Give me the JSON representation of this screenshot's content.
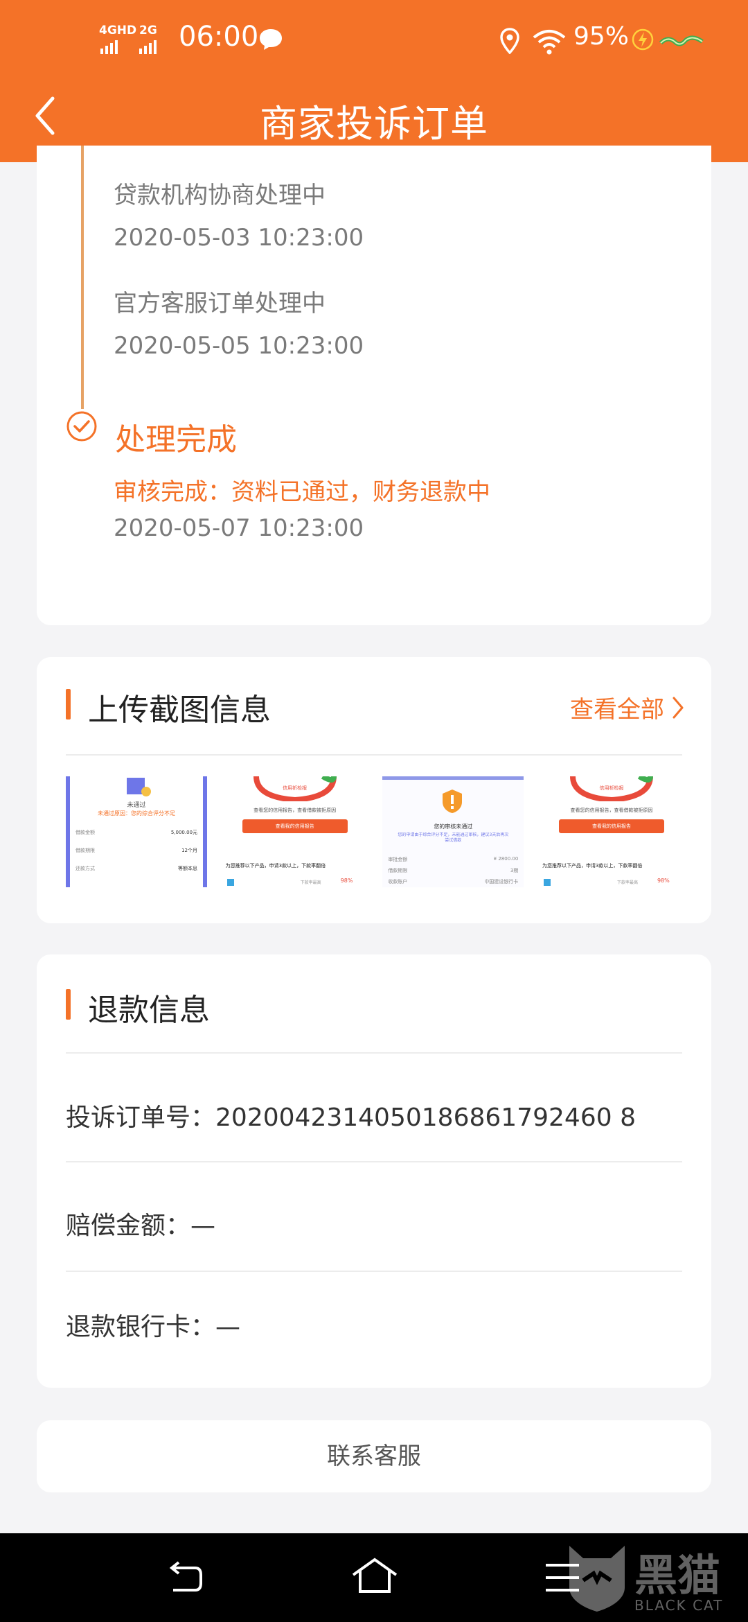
{
  "status_bar": {
    "network_1": "4GHD",
    "network_2": "2G",
    "time": "06:00",
    "battery": "95%",
    "icons": [
      "signal-icon",
      "chat-icon",
      "location-icon",
      "wifi-icon",
      "charging-icon",
      "pet-icon"
    ]
  },
  "header": {
    "title": "商家投诉订单",
    "back_icon": "chevron-left-icon"
  },
  "timeline": {
    "steps": [
      {
        "label": "贷款机构协商处理中",
        "time": "2020-05-03 10:23:00"
      },
      {
        "label": "官方客服订单处理中",
        "time": "2020-05-05 10:23:00"
      }
    ],
    "done": {
      "title": "处理完成",
      "subtitle": "审核完成：资料已通过，财务退款中",
      "time": "2020-05-07 10:23:00"
    }
  },
  "upload": {
    "title": "上传截图信息",
    "view_all": "查看全部",
    "thumbnails": [
      {
        "status": "未通过",
        "note": "未通过原因：您的综合评分不足",
        "rows": [
          {
            "k": "借款金额",
            "v": "5,000.00元"
          },
          {
            "k": "借款期限",
            "v": "12个月"
          },
          {
            "k": "还款方式",
            "v": "等额本息"
          }
        ]
      },
      {
        "gauge": "信用祈检报",
        "tip": "查看您的信用报告，查看借款被拒原因",
        "button": "查看我的信用报告",
        "footer": "为您推荐以下产品，申请3款以上，下款率翻倍",
        "tag": "下款率最高",
        "percent": "98%"
      },
      {
        "status": "您的审核未通过",
        "note": "您的申请由于综合评分不足，未能通过审核，建议3天后再次尝试借款",
        "rows": [
          {
            "k": "审批金额",
            "v": "¥ 2800.00"
          },
          {
            "k": "借款期限",
            "v": "3期"
          },
          {
            "k": "收款账户",
            "v": "中国建设银行卡"
          }
        ]
      },
      {
        "gauge": "信用祈检报",
        "tip": "查看您的信用报告，查看借款被拒原因",
        "button": "查看我的信用报告",
        "footer": "为您推荐以下产品，申请3款以上，下款率翻倍",
        "tag": "下款率最高",
        "percent": "98%"
      }
    ]
  },
  "refund": {
    "title": "退款信息",
    "order_label": "投诉订单号：",
    "order_value": "2020042314050186861792460 8",
    "amount_label": "赔偿金额：",
    "amount_value": "—",
    "card_label": "退款银行卡：",
    "card_value": "—"
  },
  "contact": {
    "label": "联系客服"
  },
  "nav_bar": {
    "icons": [
      "back-nav-icon",
      "home-nav-icon",
      "menu-nav-icon"
    ]
  },
  "watermark": {
    "text_cn": "黑猫",
    "text_en": "BLACK CAT"
  },
  "colors": {
    "primary": "#f47228",
    "nav_bg": "#000000",
    "page_bg": "#f4f4f6",
    "timeline_line": "#e6a265"
  }
}
